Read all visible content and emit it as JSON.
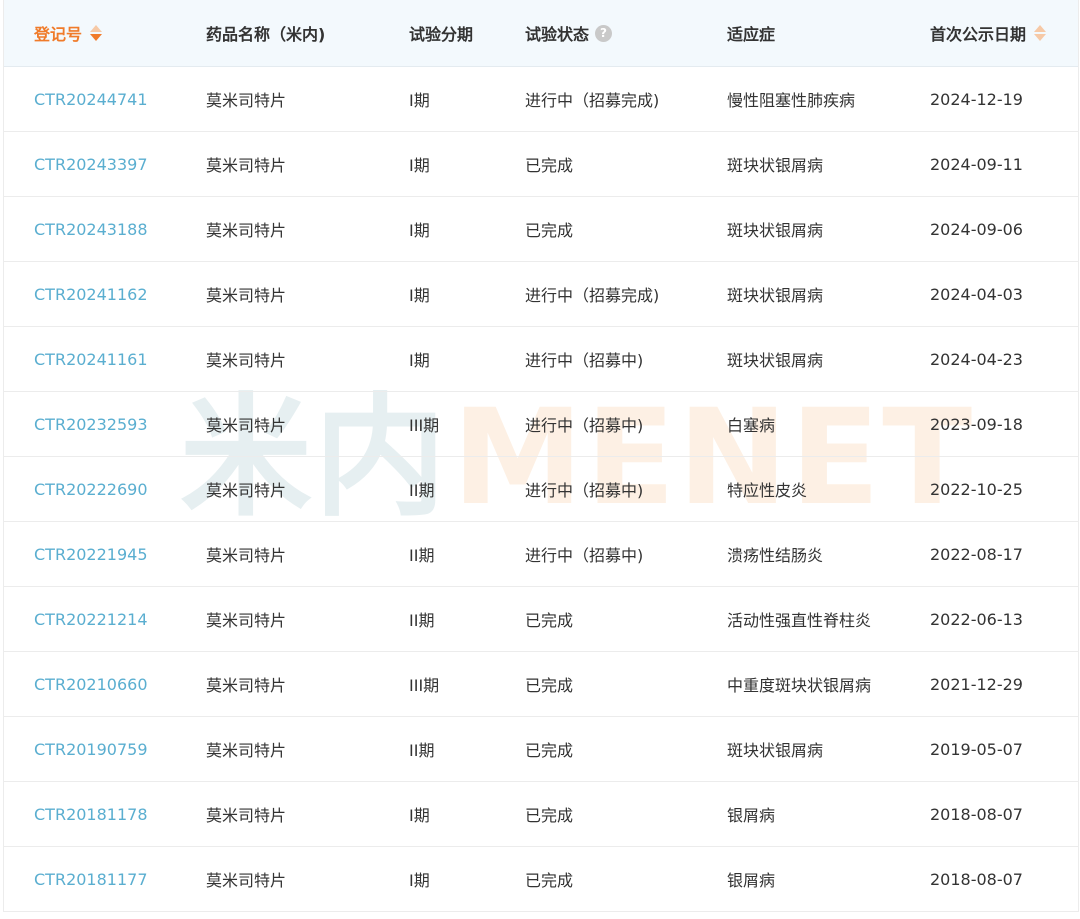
{
  "watermark": {
    "cn": "米内",
    "en": "MENET"
  },
  "columns": {
    "reg_no": "登记号",
    "drug_name": "药品名称（米内)",
    "phase": "试验分期",
    "status": "试验状态",
    "status_help": "?",
    "indication": "适应症",
    "first_date": "首次公示日期"
  },
  "rows": [
    {
      "reg_no": "CTR20244741",
      "drug": "莫米司特片",
      "phase": "I期",
      "status": "进行中（招募完成)",
      "indication": "慢性阻塞性肺疾病",
      "date": "2024-12-19"
    },
    {
      "reg_no": "CTR20243397",
      "drug": "莫米司特片",
      "phase": "I期",
      "status": "已完成",
      "indication": "斑块状银屑病",
      "date": "2024-09-11"
    },
    {
      "reg_no": "CTR20243188",
      "drug": "莫米司特片",
      "phase": "I期",
      "status": "已完成",
      "indication": "斑块状银屑病",
      "date": "2024-09-06"
    },
    {
      "reg_no": "CTR20241162",
      "drug": "莫米司特片",
      "phase": "I期",
      "status": "进行中（招募完成)",
      "indication": "斑块状银屑病",
      "date": "2024-04-03"
    },
    {
      "reg_no": "CTR20241161",
      "drug": "莫米司特片",
      "phase": "I期",
      "status": "进行中（招募中)",
      "indication": "斑块状银屑病",
      "date": "2024-04-23"
    },
    {
      "reg_no": "CTR20232593",
      "drug": "莫米司特片",
      "phase": "III期",
      "status": "进行中（招募中)",
      "indication": "白塞病",
      "date": "2023-09-18"
    },
    {
      "reg_no": "CTR20222690",
      "drug": "莫米司特片",
      "phase": "II期",
      "status": "进行中（招募中)",
      "indication": "特应性皮炎",
      "date": "2022-10-25"
    },
    {
      "reg_no": "CTR20221945",
      "drug": "莫米司特片",
      "phase": "II期",
      "status": "进行中（招募中)",
      "indication": "溃疡性结肠炎",
      "date": "2022-08-17"
    },
    {
      "reg_no": "CTR20221214",
      "drug": "莫米司特片",
      "phase": "II期",
      "status": "已完成",
      "indication": "活动性强直性脊柱炎",
      "date": "2022-06-13"
    },
    {
      "reg_no": "CTR20210660",
      "drug": "莫米司特片",
      "phase": "III期",
      "status": "已完成",
      "indication": "中重度斑块状银屑病",
      "date": "2021-12-29"
    },
    {
      "reg_no": "CTR20190759",
      "drug": "莫米司特片",
      "phase": "II期",
      "status": "已完成",
      "indication": "斑块状银屑病",
      "date": "2019-05-07"
    },
    {
      "reg_no": "CTR20181178",
      "drug": "莫米司特片",
      "phase": "I期",
      "status": "已完成",
      "indication": "银屑病",
      "date": "2018-08-07"
    },
    {
      "reg_no": "CTR20181177",
      "drug": "莫米司特片",
      "phase": "I期",
      "status": "已完成",
      "indication": "银屑病",
      "date": "2018-08-07"
    }
  ],
  "colors": {
    "accent": "#f07b2a",
    "link": "#5aaed0",
    "header_bg": "#f3f9fd"
  }
}
